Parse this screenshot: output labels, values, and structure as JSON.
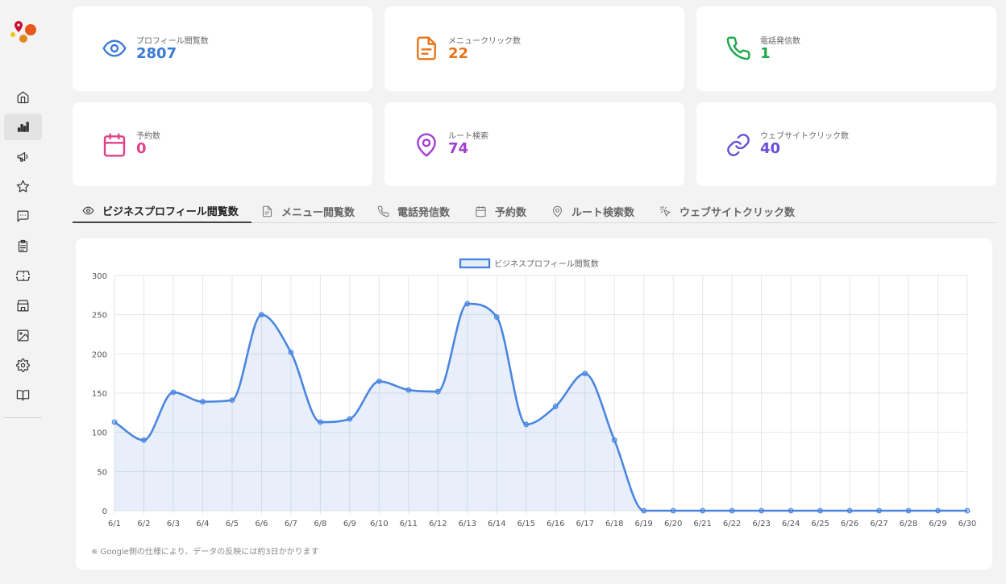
{
  "stats": [
    {
      "label": "プロフィール閲覧数",
      "value": "2807",
      "color": "#3a7bd5",
      "icon": "eye-icon"
    },
    {
      "label": "メニュークリック数",
      "value": "22",
      "color": "#ea7317",
      "icon": "file-text-icon"
    },
    {
      "label": "電話発信数",
      "value": "1",
      "color": "#1ba84a",
      "icon": "phone-icon"
    },
    {
      "label": "予約数",
      "value": "0",
      "color": "#e0408a",
      "icon": "calendar-icon"
    },
    {
      "label": "ルート検索",
      "value": "74",
      "color": "#a23fd1",
      "icon": "map-pin-icon"
    },
    {
      "label": "ウェブサイトクリック数",
      "value": "40",
      "color": "#6a4fd8",
      "icon": "link-icon"
    }
  ],
  "tabs": [
    {
      "label": "ビジネスプロフィール閲覧数",
      "icon": "eye-icon",
      "active": true
    },
    {
      "label": "メニュー閲覧数",
      "icon": "file-text-icon"
    },
    {
      "label": "電話発信数",
      "icon": "phone-icon"
    },
    {
      "label": "予約数",
      "icon": "calendar-icon"
    },
    {
      "label": "ルート検索数",
      "icon": "map-pin-icon"
    },
    {
      "label": "ウェブサイトクリック数",
      "icon": "pointer-click-icon"
    }
  ],
  "sidebar": {
    "items": [
      {
        "icon": "home-icon"
      },
      {
        "icon": "bar-chart-icon",
        "active": true
      },
      {
        "icon": "megaphone-icon"
      },
      {
        "icon": "star-icon"
      },
      {
        "icon": "message-icon"
      },
      {
        "icon": "clipboard-icon"
      },
      {
        "icon": "ticket-icon"
      },
      {
        "icon": "store-icon"
      },
      {
        "icon": "image-icon"
      },
      {
        "icon": "settings-icon"
      },
      {
        "icon": "book-icon"
      }
    ]
  },
  "note": "※ Google側の仕様により、データの反映には約3日かかります",
  "chart_data": {
    "type": "area",
    "categories": [
      "6/1",
      "6/2",
      "6/3",
      "6/4",
      "6/5",
      "6/6",
      "6/7",
      "6/8",
      "6/9",
      "6/10",
      "6/11",
      "6/12",
      "6/13",
      "6/14",
      "6/15",
      "6/16",
      "6/17",
      "6/18",
      "6/19",
      "6/20",
      "6/21",
      "6/22",
      "6/23",
      "6/24",
      "6/25",
      "6/26",
      "6/27",
      "6/28",
      "6/29",
      "6/30"
    ],
    "series": [
      {
        "name": "ビジネスプロフィール閲覧数",
        "values": [
          113,
          90,
          151,
          139,
          141,
          250,
          202,
          113,
          117,
          165,
          154,
          152,
          264,
          247,
          110,
          133,
          175,
          90,
          0,
          0,
          0,
          0,
          0,
          0,
          0,
          0,
          0,
          0,
          0,
          0
        ],
        "color": "#4a86e0"
      }
    ],
    "ylim": [
      0,
      300
    ],
    "yticks": [
      0,
      50,
      100,
      150,
      200,
      250,
      300
    ],
    "grid": true,
    "legend": "top-center"
  }
}
